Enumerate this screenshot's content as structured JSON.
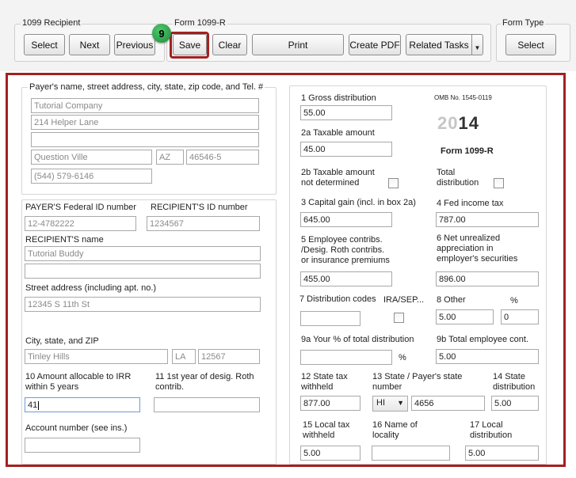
{
  "toolbar": {
    "recipient_group": "1099 Recipient",
    "form_group": "Form 1099-R",
    "formtype_group": "Form Type",
    "select_label": "Select",
    "next_label": "Next",
    "previous_label": "Previous",
    "save_label": "Save",
    "clear_label": "Clear",
    "print_label": "Print",
    "create_pdf_label": "Create PDF",
    "related_tasks_label": "Related Tasks",
    "formtype_select_label": "Select",
    "step_number": "9"
  },
  "payer": {
    "heading": "Payer's name, street address, city, state, zip code, and Tel. #",
    "name": "Tutorial Company",
    "address1": "214 Helper Lane",
    "address2": "",
    "city": "Question Ville",
    "state": "AZ",
    "zip": "46546-5",
    "phone": "(544) 579-6146"
  },
  "ids": {
    "payer_fed_label": "PAYER'S Federal ID number",
    "payer_fed_value": "12-4782222",
    "recipient_id_label": "RECIPIENT'S ID number",
    "recipient_id_value": "1234567",
    "recipient_name_label": "RECIPIENT'S name",
    "recipient_name_value": "Tutorial Buddy",
    "recipient_name2_value": "",
    "street_label": "Street address (including apt. no.)",
    "street_value": "12345 S 11th St",
    "city_label": "City, state, and ZIP",
    "city_value": "Tinley Hills",
    "state_value": "LA",
    "zip_value": "12567",
    "box10_label_1": "10 Amount allocable to IRR",
    "box10_label_2": "within 5 years",
    "box10_value": "41",
    "box11_label_1": "11 1st year of desig. Roth",
    "box11_label_2": "contrib.",
    "box11_value": "",
    "account_label": "Account number (see ins.)",
    "account_value": ""
  },
  "form": {
    "omb": "OMB No. 1545-0119",
    "year_light": "20",
    "year_dark": "14",
    "form_name": "Form 1099-R",
    "box1_label": "1 Gross distribution",
    "box1_value": "55.00",
    "box2a_label": "2a Taxable amount",
    "box2a_value": "45.00",
    "box2b_label_1": "2b Taxable amount",
    "box2b_label_2": "not determined",
    "total_label_1": "Total",
    "total_label_2": "distribution",
    "box3_label": "3 Capital gain (incl. in box 2a)",
    "box3_value": "645.00",
    "box4_label": "4 Fed income tax",
    "box4_value": "787.00",
    "box5_label_1": "5 Employee contribs.",
    "box5_label_2": "/Desig. Roth contribs.",
    "box5_label_3": " or insurance premiums",
    "box5_value": "455.00",
    "box6_label_1": "6 Net unrealized",
    "box6_label_2": "appreciation in",
    "box6_label_3": "employer's securities",
    "box6_value": "896.00",
    "box7_label": "7 Distribution codes",
    "ira_label": "IRA/SEP...",
    "box7_value": "",
    "box8_label": "8 Other",
    "box8_pct_symbol": "%",
    "box8_value": "5.00",
    "box8_pct_value": "0",
    "box9a_label": "9a Your % of total distribution",
    "box9a_value": "",
    "box9a_pct_symbol": "%",
    "box9b_label": "9b Total employee cont.",
    "box9b_value": "5.00",
    "box12_label_1": "12 State tax",
    "box12_label_2": "withheld",
    "box12_value": "877.00",
    "box13_label_1": "13 State / Payer's state",
    "box13_label_2": "number",
    "box13_state": "HI",
    "box13_value": "4656",
    "box14_label_1": "14 State",
    "box14_label_2": "distribution",
    "box14_value": "5.00",
    "box15_label_1": "15 Local tax",
    "box15_label_2": "withheld",
    "box15_value": "5.00",
    "box16_label_1": "16 Name of",
    "box16_label_2": "locality",
    "box16_value": "",
    "box17_label_1": "17 Local",
    "box17_label_2": "distribution",
    "box17_value": "5.00"
  },
  "colors": {
    "highlight": "#a42020",
    "step_badge": "#2fa04e"
  }
}
